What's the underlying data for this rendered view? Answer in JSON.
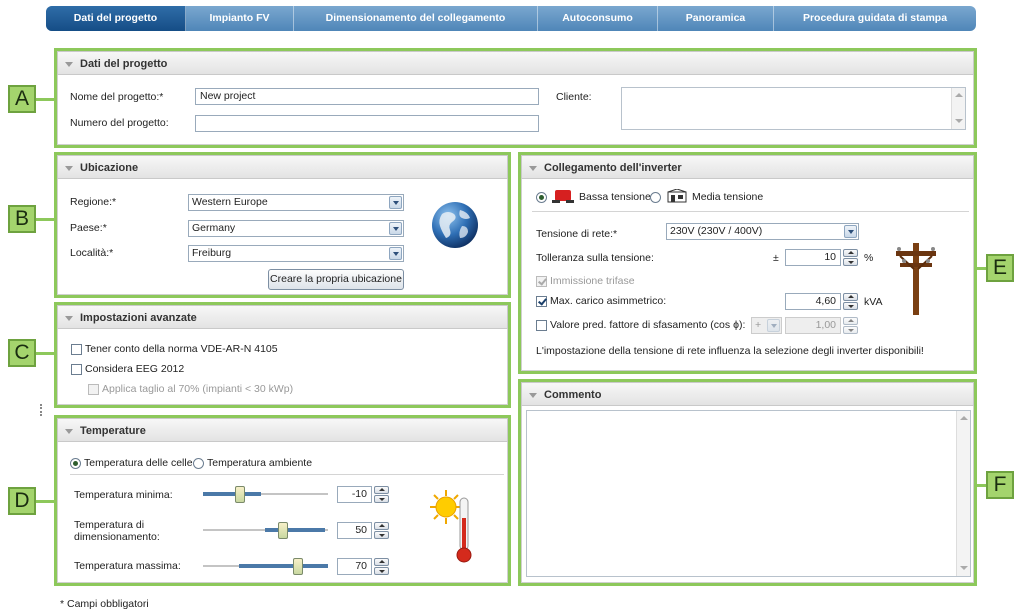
{
  "wizard": {
    "steps": [
      "Dati del progetto",
      "Impianto FV",
      "Dimensionamento del collegamento",
      "Autoconsumo",
      "Panoramica",
      "Procedura guidata di stampa"
    ],
    "active_index": 0
  },
  "callouts": [
    "A",
    "B",
    "C",
    "D",
    "E",
    "F"
  ],
  "project": {
    "title": "Dati del progetto",
    "name_label": "Nome del progetto:*",
    "name_value": "New project",
    "number_label": "Numero del progetto:",
    "number_value": "",
    "client_label": "Cliente:",
    "client_value": ""
  },
  "location": {
    "title": "Ubicazione",
    "region_label": "Regione:*",
    "region_value": "Western Europe",
    "country_label": "Paese:*",
    "country_value": "Germany",
    "place_label": "Località:*",
    "place_value": "Freiburg",
    "create_button": "Creare la propria ubicazione",
    "icon": "globe-icon"
  },
  "advanced": {
    "title": "Impostazioni avanzate",
    "opt1_label": "Tener conto della norma VDE-AR-N 4105",
    "opt1_checked": false,
    "opt2_label": "Considera EEG 2012",
    "opt2_checked": false,
    "opt3_label": "Applica taglio al 70% (impianti < 30 kWp)",
    "opt3_checked": false,
    "opt3_enabled": false
  },
  "temperature": {
    "title": "Temperature",
    "radio_cells": "Temperatura delle celle",
    "radio_ambient": "Temperatura ambiente",
    "selected": "cells",
    "min_label": "Temperatura minima:",
    "min_value": "-10",
    "dim_label_1": "Temperatura di",
    "dim_label_2": "dimensionamento:",
    "dim_value": "50",
    "max_label": "Temperatura massima:",
    "max_value": "70",
    "icon": "sun-thermometer-icon"
  },
  "inverter": {
    "title": "Collegamento dell'inverter",
    "low_voltage": "Bassa tensione",
    "medium_voltage": "Media tensione",
    "selected": "low",
    "grid_voltage_label": "Tensione di rete:*",
    "grid_voltage_value": "230V (230V / 400V)",
    "tolerance_label": "Tolleranza sulla tensione:",
    "tolerance_prefix": "±",
    "tolerance_value": "10",
    "tolerance_unit": "%",
    "three_phase_label": "Immissione trifase",
    "three_phase_checked": true,
    "three_phase_enabled": false,
    "max_asym_label": "Max. carico asimmetrico:",
    "max_asym_checked": true,
    "max_asym_value": "4,60",
    "max_asym_unit": "kVA",
    "cosphi_label": "Valore pred. fattore di sfasamento (cos ϕ):",
    "cosphi_checked": false,
    "cosphi_sign": "+",
    "cosphi_value": "1,00",
    "note": "L'impostazione della tensione di rete influenza la selezione degli inverter disponibili!",
    "icon": "utility-pole-icon"
  },
  "comment": {
    "title": "Commento",
    "value": ""
  },
  "footer": {
    "required_note": "* Campi obbligatori"
  }
}
